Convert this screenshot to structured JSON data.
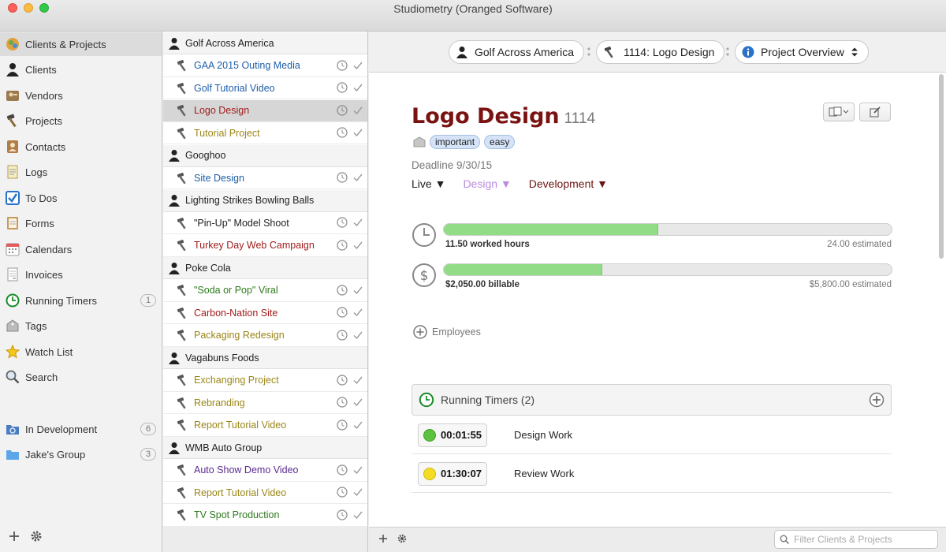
{
  "window": {
    "title": "Studiometry (Oranged Software)"
  },
  "sidebar": {
    "items": [
      {
        "label": "Clients & Projects",
        "icon": "clients-projects-icon"
      },
      {
        "label": "Clients",
        "icon": "person-icon"
      },
      {
        "label": "Vendors",
        "icon": "vendor-icon"
      },
      {
        "label": "Projects",
        "icon": "hammer-icon"
      },
      {
        "label": "Contacts",
        "icon": "contacts-icon"
      },
      {
        "label": "Logs",
        "icon": "log-icon"
      },
      {
        "label": "To Dos",
        "icon": "checkbox-icon"
      },
      {
        "label": "Forms",
        "icon": "forms-icon"
      },
      {
        "label": "Calendars",
        "icon": "calendar-icon"
      },
      {
        "label": "Invoices",
        "icon": "invoice-icon"
      },
      {
        "label": "Running Timers",
        "icon": "timer-icon",
        "badge": "1"
      },
      {
        "label": "Tags",
        "icon": "tag-icon"
      },
      {
        "label": "Watch List",
        "icon": "star-icon"
      },
      {
        "label": "Search",
        "icon": "search-icon"
      }
    ],
    "smart_groups": [
      {
        "label": "In Development",
        "badge": "6"
      },
      {
        "label": "Jake's Group",
        "badge": "3"
      }
    ]
  },
  "project_list": {
    "groups": [
      {
        "client": "Golf Across America",
        "projects": [
          {
            "name": "GAA 2015 Outing Media",
            "color": "#1d5fa8"
          },
          {
            "name": "Golf Tutorial Video",
            "color": "#1d5fa8"
          },
          {
            "name": "Logo Design",
            "color": "#a11c1c",
            "selected": true
          },
          {
            "name": "Tutorial Project",
            "color": "#9a8617"
          }
        ]
      },
      {
        "client": "Googhoo",
        "projects": [
          {
            "name": "Site Design",
            "color": "#1d5fa8"
          }
        ]
      },
      {
        "client": "Lighting Strikes Bowling Balls",
        "projects": [
          {
            "name": "\"Pin-Up\" Model Shoot",
            "color": "#222222"
          },
          {
            "name": "Turkey Day Web Campaign",
            "color": "#a11c1c"
          }
        ]
      },
      {
        "client": "Poke Cola",
        "projects": [
          {
            "name": "\"Soda or Pop\" Viral",
            "color": "#2d7a1d"
          },
          {
            "name": "Carbon-Nation Site",
            "color": "#a11c1c"
          },
          {
            "name": "Packaging Redesign",
            "color": "#9a8617"
          }
        ]
      },
      {
        "client": "Vagabuns Foods",
        "projects": [
          {
            "name": "Exchanging Project",
            "color": "#9a8617"
          },
          {
            "name": "Rebranding",
            "color": "#9a8617"
          },
          {
            "name": "Report Tutorial Video",
            "color": "#9a8617"
          }
        ]
      },
      {
        "client": "WMB Auto Group",
        "projects": [
          {
            "name": "Auto Show Demo Video",
            "color": "#5a2a90"
          },
          {
            "name": "Report Tutorial Video",
            "color": "#9a8617"
          },
          {
            "name": "TV Spot Production",
            "color": "#2d7a1d"
          }
        ]
      }
    ]
  },
  "pathbar": {
    "client": "Golf Across America",
    "project": "1114: Logo Design",
    "view": "Project Overview"
  },
  "project": {
    "title": "Logo Design",
    "number": "1114",
    "tags": [
      "important",
      "easy"
    ],
    "deadline": "Deadline 9/30/15",
    "statuses": [
      {
        "label": "Live ▼",
        "color": "#222222"
      },
      {
        "label": "Design ▼",
        "color": "#b98be0"
      },
      {
        "label": "Development ▼",
        "color": "#6d1515"
      }
    ],
    "hours": {
      "label": "11.50 worked hours",
      "estimate": "24.00 estimated",
      "progress": 0.479
    },
    "billable": {
      "label": "$2,050.00 billable",
      "estimate": "$5,800.00 estimated",
      "progress": 0.353
    },
    "employees_label": "Employees"
  },
  "timers": {
    "header": "Running Timers (2)",
    "items": [
      {
        "time": "00:01:55",
        "task": "Design Work",
        "dot_color": "#5cc23f"
      },
      {
        "time": "01:30:07",
        "task": "Review Work",
        "dot_color": "#f5dc24"
      }
    ]
  },
  "filter": {
    "placeholder": "Filter Clients & Projects"
  },
  "colors": {
    "bar_fill": "#92dc87",
    "title": "#7a1212",
    "accent_blue": "#1d5fa8"
  }
}
